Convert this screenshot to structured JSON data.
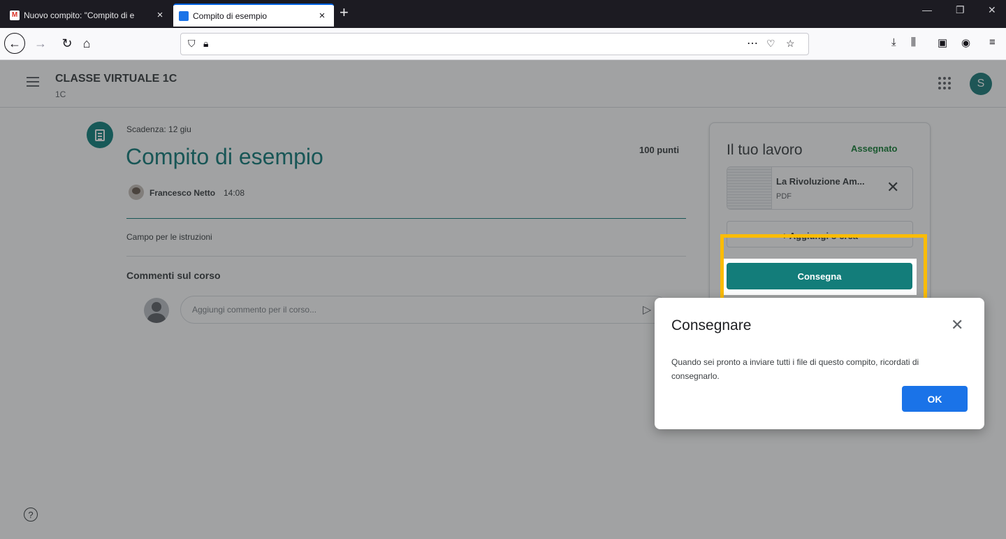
{
  "browser": {
    "tabs": [
      {
        "title": "Nuovo compito: \"Compito di e",
        "favicon": "gmail-icon"
      },
      {
        "title": "Compito di esempio",
        "favicon": "classroom-icon"
      }
    ],
    "tab_close": "×",
    "new_tab": "+",
    "window_controls": {
      "minimize": "—",
      "maximize": "❐",
      "close": "✕"
    },
    "url": ""
  },
  "header": {
    "class_title": "CLASSE VIRTUALE 1C",
    "class_section": "1C",
    "avatar_letter": "S"
  },
  "assignment": {
    "deadline": "Scadenza: 12 giu",
    "title": "Compito di esempio",
    "points": "100 punti",
    "author": "Francesco Netto",
    "time": "14:08",
    "instructions": "Campo per le istruzioni"
  },
  "comments": {
    "title": "Commenti sul corso",
    "placeholder": "Aggiungi commento per il corso..."
  },
  "work": {
    "title": "Il tuo lavoro",
    "status": "Assegnato",
    "attachment": {
      "name": "La Rivoluzione Am...",
      "type": "PDF"
    },
    "add_label": "+ Aggiungi o crea",
    "submit_label": "Consegna"
  },
  "dialog": {
    "title": "Consegnare",
    "body": "Quando sei pronto a inviare tutti i file di questo compito, ricordati di consegnarlo.",
    "ok_label": "OK"
  },
  "colors": {
    "accent": "#137d7a",
    "status_green": "#188038",
    "ok_blue": "#1a73e8",
    "highlight": "#fbbc04"
  }
}
